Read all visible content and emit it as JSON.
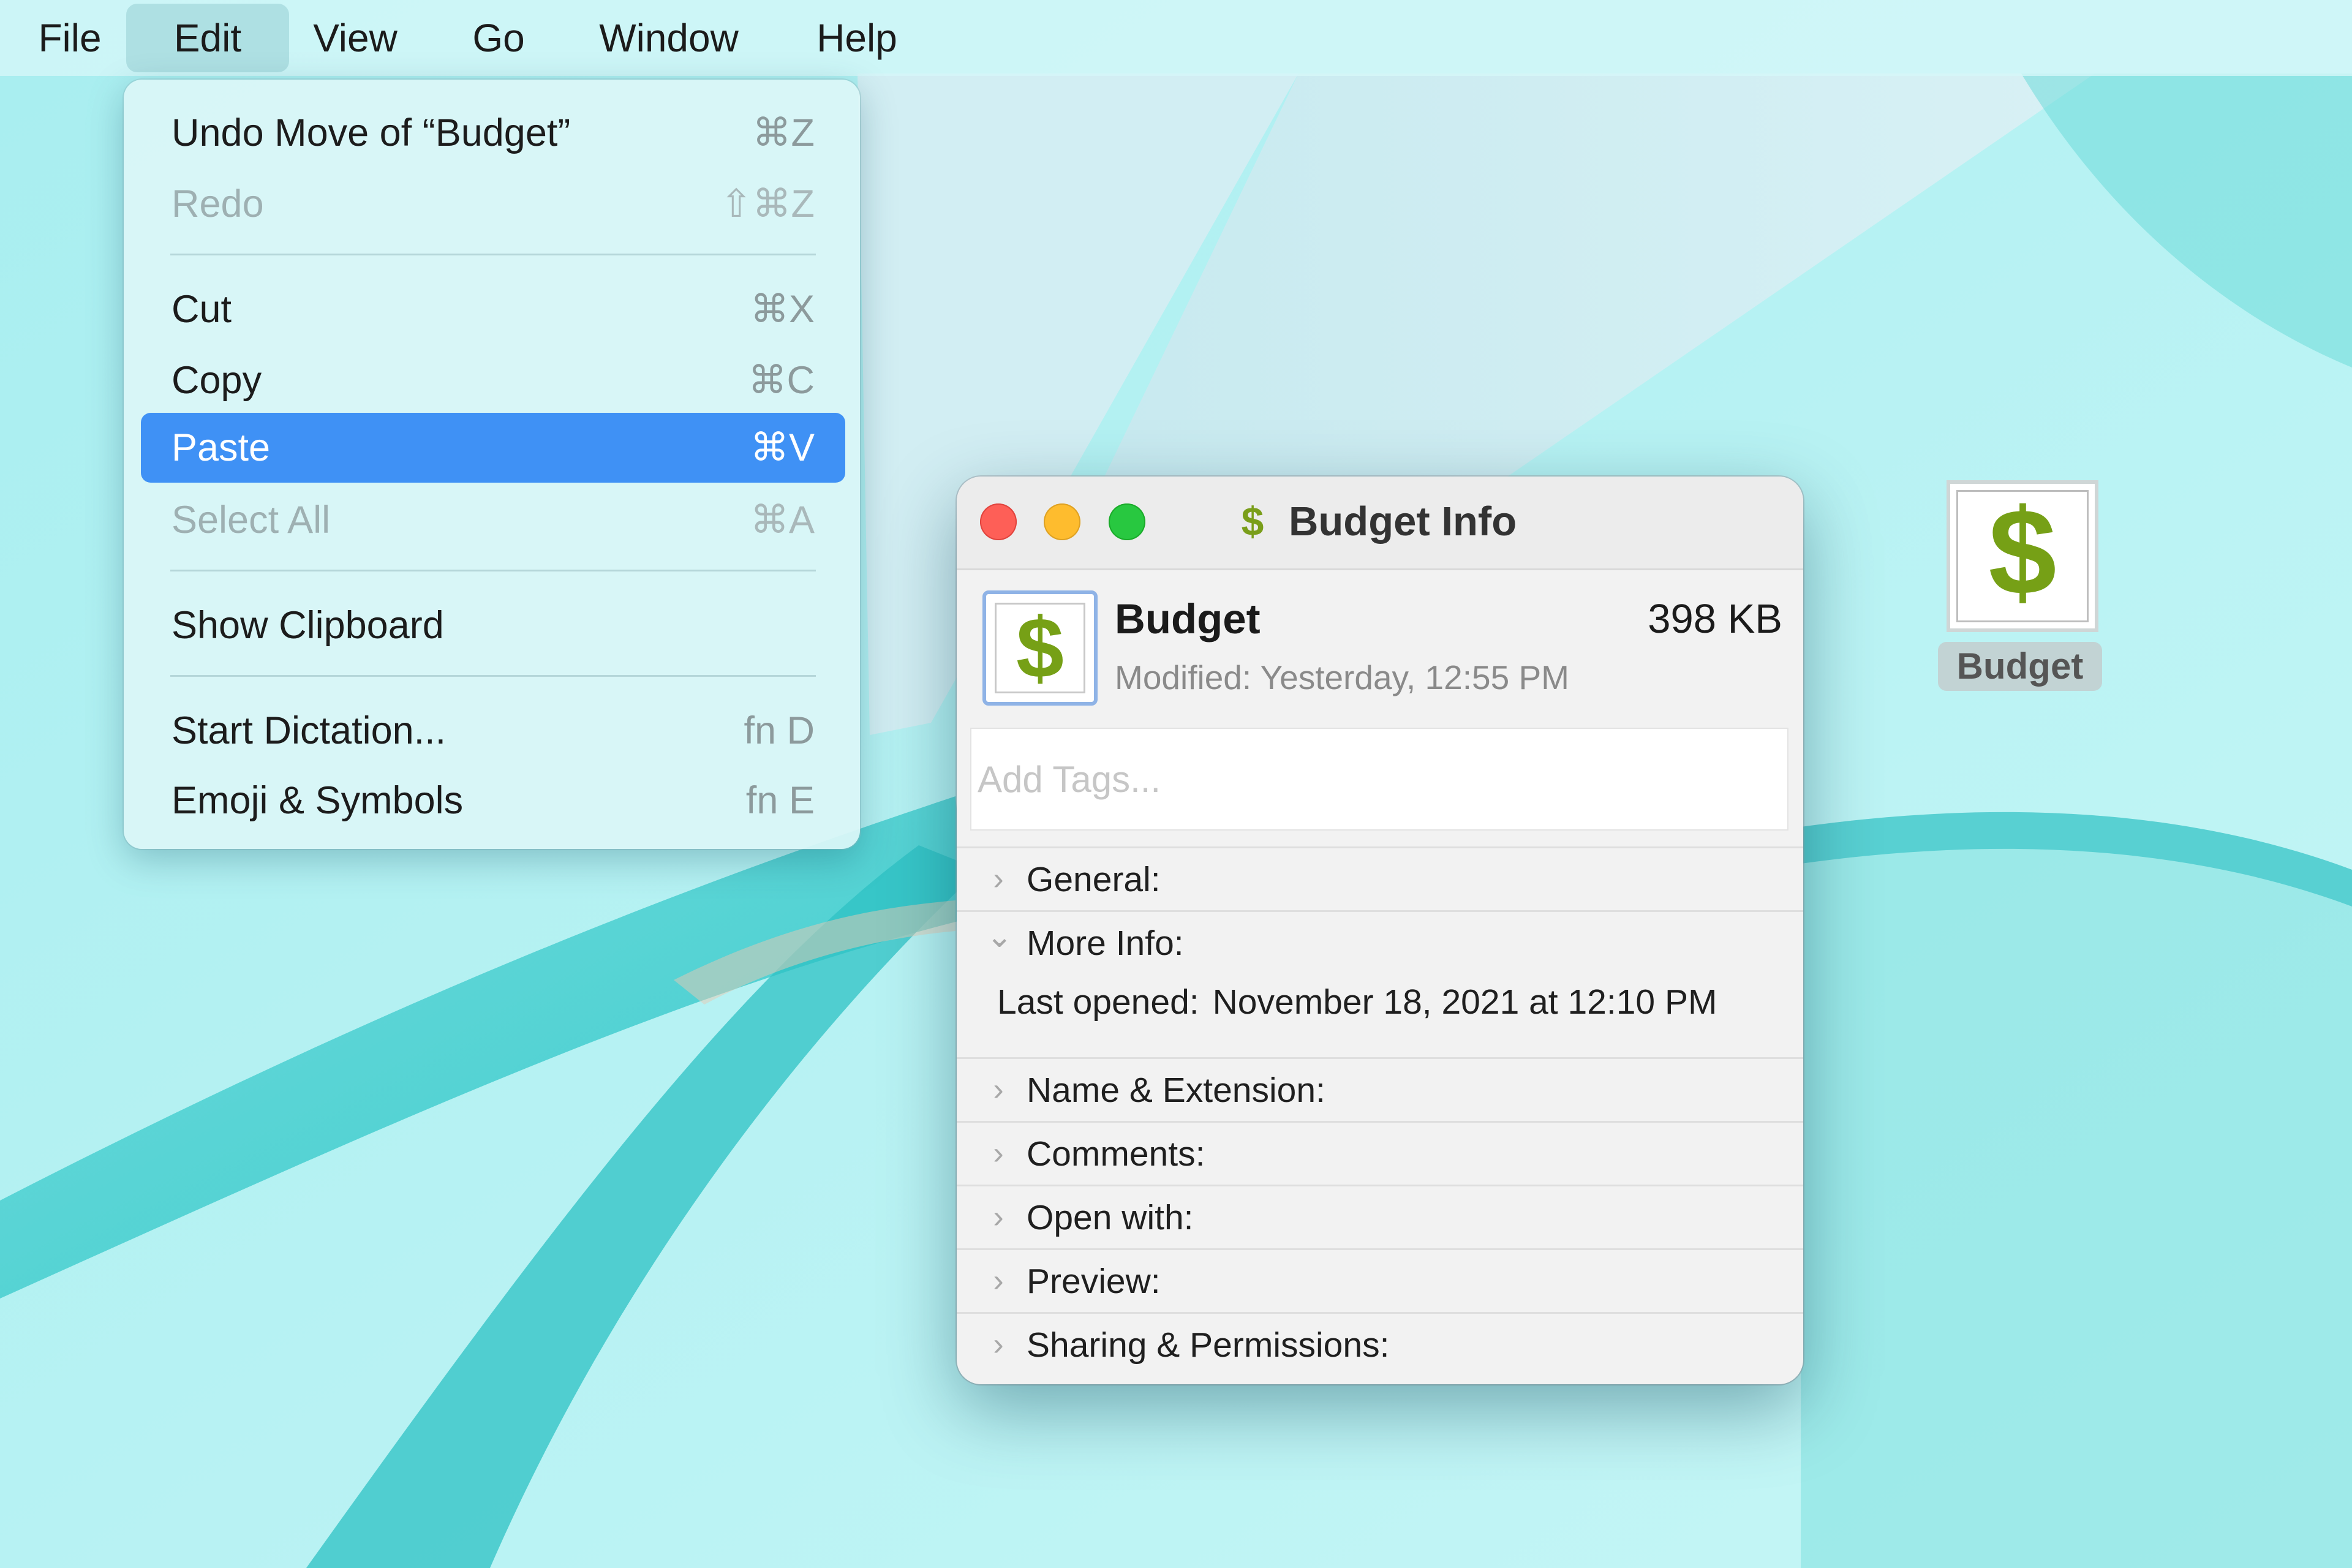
{
  "menubar": {
    "items": [
      "File",
      "Edit",
      "View",
      "Go",
      "Window",
      "Help"
    ],
    "active": "Edit"
  },
  "edit_menu": {
    "items": [
      {
        "label": "Undo Move of “Budget”",
        "shortcut": "⌘Z",
        "enabled": true
      },
      {
        "label": "Redo",
        "shortcut": "⇧⌘Z",
        "enabled": false
      },
      {
        "label": "Cut",
        "shortcut": "⌘X",
        "enabled": true
      },
      {
        "label": "Copy",
        "shortcut": "⌘C",
        "enabled": true
      },
      {
        "label": "Paste",
        "shortcut": "⌘V",
        "enabled": true,
        "highlighted": true
      },
      {
        "label": "Select All",
        "shortcut": "⌘A",
        "enabled": false
      },
      {
        "label": "Show Clipboard",
        "shortcut": "",
        "enabled": true
      },
      {
        "label": "Start Dictation...",
        "shortcut": "fn D",
        "enabled": true
      },
      {
        "label": "Emoji & Symbols",
        "shortcut": "fn E",
        "enabled": true
      }
    ]
  },
  "info_window": {
    "title": "Budget Info",
    "title_icon": "$",
    "file_name": "Budget",
    "file_size": "398 KB",
    "modified_label": "Modified:",
    "modified_value": "Yesterday, 12:55 PM",
    "tags_placeholder": "Add Tags...",
    "sections": [
      {
        "label": "General:",
        "expanded": false
      },
      {
        "label": "More Info:",
        "expanded": true
      },
      {
        "label": "Name & Extension:",
        "expanded": false
      },
      {
        "label": "Comments:",
        "expanded": false
      },
      {
        "label": "Open with:",
        "expanded": false
      },
      {
        "label": "Preview:",
        "expanded": false
      },
      {
        "label": "Sharing & Permissions:",
        "expanded": false
      }
    ],
    "more_info": {
      "last_opened_label": "Last opened:",
      "last_opened_value": "November 18, 2021 at 12:10 PM"
    }
  },
  "desktop_icon": {
    "label": "Budget",
    "glyph": "$"
  },
  "icons": {
    "chevron_right": "›",
    "chevron_down": "⌄"
  },
  "colors": {
    "highlight": "#3f91f5",
    "dollar_green": "#76a016",
    "close": "#fe5f57",
    "minimize": "#febc2e",
    "zoom": "#28c840"
  }
}
